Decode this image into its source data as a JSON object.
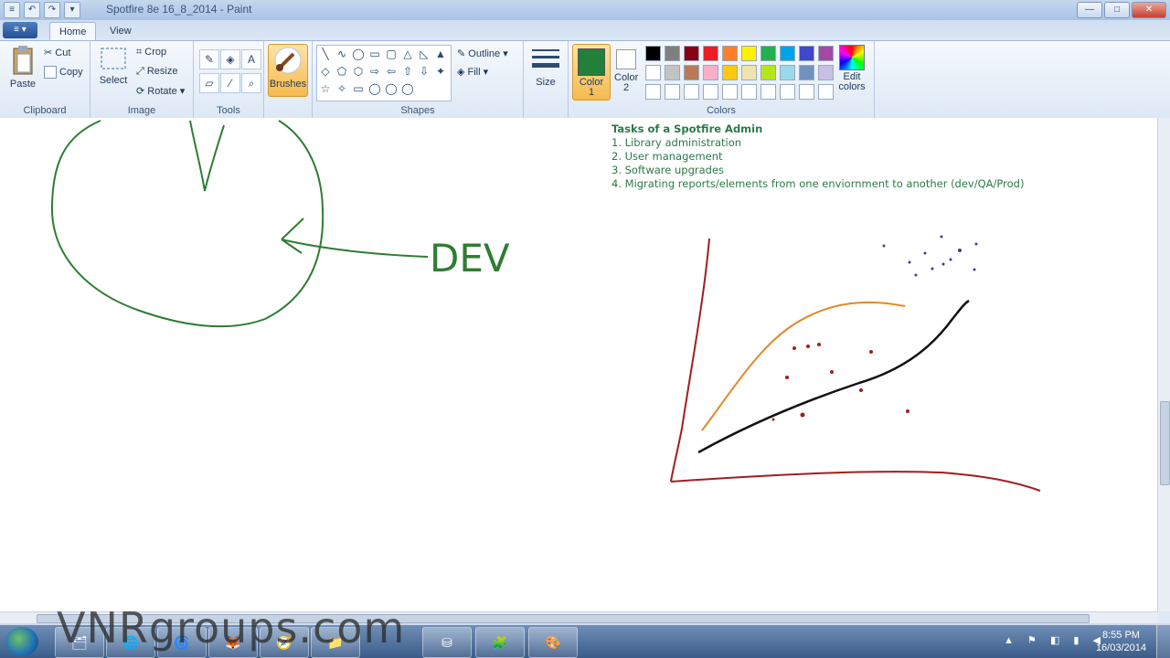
{
  "window": {
    "title": "Spotfire 8e 16_8_2014 - Paint",
    "quick_access": [
      "≡",
      "↶",
      "↷",
      "▾"
    ],
    "controls": {
      "minimize": "—",
      "maximize": "□",
      "close": "✕"
    }
  },
  "ribbon_tabs": {
    "menu": "≡ ▾",
    "home": "Home",
    "view": "View"
  },
  "clipboard": {
    "paste": "Paste",
    "cut": "Cut",
    "copy": "Copy",
    "label": "Clipboard"
  },
  "image": {
    "select": "Select",
    "crop": "Crop",
    "resize": "Resize",
    "rotate": "Rotate",
    "label": "Image"
  },
  "tools": {
    "label": "Tools"
  },
  "brushes": {
    "label": "Brushes"
  },
  "shapes": {
    "label": "Shapes",
    "outline": "Outline",
    "fill": "Fill",
    "glyphs": [
      "╲",
      "∿",
      "◯",
      "▭",
      "▢",
      "△",
      "◺",
      "▲",
      "◇",
      "⬠",
      "⬡",
      "⇨",
      "⇦",
      "⇧",
      "⇩",
      "✦",
      "☆",
      "✧",
      "▭",
      "◯",
      "◯",
      "◯"
    ]
  },
  "size": {
    "label": "Size"
  },
  "colors": {
    "color1": "Color 1",
    "color2": "Color 2",
    "edit": "Edit colors",
    "label": "Colors",
    "color1_value": "#22803a",
    "palette": [
      "#000000",
      "#7f7f7f",
      "#880015",
      "#ed1c24",
      "#ff7f27",
      "#fff200",
      "#22b14c",
      "#00a2e8",
      "#3f48cc",
      "#a349a4",
      "#ffffff",
      "#c3c3c3",
      "#b97a57",
      "#ffaec9",
      "#ffc90e",
      "#efe4b0",
      "#b5e61d",
      "#99d9ea",
      "#7092be",
      "#c8bfe7",
      "#ffffff",
      "#ffffff",
      "#ffffff",
      "#ffffff",
      "#ffffff",
      "#ffffff",
      "#ffffff",
      "#ffffff",
      "#ffffff",
      "#ffffff"
    ]
  },
  "canvas": {
    "dev_label": "DEV",
    "tasks_title": "Tasks of a Spotfire Admin",
    "tasks": [
      "1. Library administration",
      "2. User management",
      "3. Software upgrades",
      "4. Migrating reports/elements from one enviornment to another (dev/QA/Prod)"
    ],
    "ink_green": "#2e7d32",
    "ink_red": "#a01f1f",
    "ink_orange": "#e08a2a"
  },
  "taskbar": {
    "items": [
      "🗂",
      "🌐",
      "🌀",
      "🦊",
      "🧭",
      "📁",
      "⛁",
      "🧩",
      "🎨"
    ],
    "tray": "▲ ⚑ ◧ ▮ ◀",
    "time": "8:55 PM",
    "date": "16/03/2014"
  },
  "watermark": "VNRgroups.com"
}
